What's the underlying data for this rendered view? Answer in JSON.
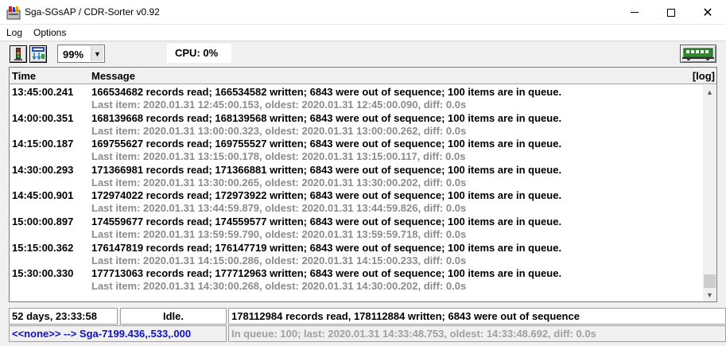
{
  "window": {
    "title": "Sga-SGsAP / CDR-Sorter  v0.92",
    "minimize_glyph": "",
    "maximize_glyph": "",
    "close_glyph": "✕"
  },
  "menu": {
    "log_label": "Log",
    "options_label": "Options"
  },
  "toolbar": {
    "zoom_value": "99%",
    "cpu_label": "CPU:  0%",
    "button_icons": [
      "traffic-light-icon",
      "auto-sort-icon",
      "train-icon"
    ]
  },
  "log": {
    "columns": {
      "time": "Time",
      "message": "Message",
      "log_button": "[log]"
    },
    "entries": [
      {
        "time": "13:45:00.241",
        "message": "166534682 records read; 166534582 written; 6843 were out of sequence; 100 items are in queue.",
        "detail": "Last item: 2020.01.31 12:45:00.153, oldest: 2020.01.31 12:45:00.090, diff: 0.0s"
      },
      {
        "time": "14:00:00.351",
        "message": "168139668 records read; 168139568 written; 6843 were out of sequence; 100 items are in queue.",
        "detail": "Last item: 2020.01.31 13:00:00.323, oldest: 2020.01.31 13:00:00.262, diff: 0.0s"
      },
      {
        "time": "14:15:00.187",
        "message": "169755627 records read; 169755527 written; 6843 were out of sequence; 100 items are in queue.",
        "detail": "Last item: 2020.01.31 13:15:00.178, oldest: 2020.01.31 13:15:00.117, diff: 0.0s"
      },
      {
        "time": "14:30:00.293",
        "message": "171366981 records read; 171366881 written; 6843 were out of sequence; 100 items are in queue.",
        "detail": "Last item: 2020.01.31 13:30:00.265, oldest: 2020.01.31 13:30:00.202, diff: 0.0s"
      },
      {
        "time": "14:45:00.901",
        "message": "172974022 records read; 172973922 written; 6843 were out of sequence; 100 items are in queue.",
        "detail": "Last item: 2020.01.31 13:44:59.879, oldest: 2020.01.31 13:44:59.826, diff: 0.0s"
      },
      {
        "time": "15:00:00.897",
        "message": "174559677 records read; 174559577 written; 6843 were out of sequence; 100 items are in queue.",
        "detail": "Last item: 2020.01.31 13:59:59.790, oldest: 2020.01.31 13:59:59.718, diff: 0.0s"
      },
      {
        "time": "15:15:00.362",
        "message": "176147819 records read; 176147719 written; 6843 were out of sequence; 100 items are in queue.",
        "detail": "Last item: 2020.01.31 14:15:00.286, oldest: 2020.01.31 14:15:00.233, diff: 0.0s"
      },
      {
        "time": "15:30:00.330",
        "message": "177713063 records read; 177712963 written; 6843 were out of sequence; 100 items are in queue.",
        "detail": "Last item: 2020.01.31 14:30:00.268, oldest: 2020.01.31 14:30:00.202, diff: 0.0s"
      }
    ]
  },
  "status": {
    "uptime": "52 days, 23:33:58",
    "state": "Idle.",
    "summary": "178112984 records read, 178112884 written; 6843 were out of sequence",
    "route": "<<none>> --> Sga-7199.436,.533,.000",
    "queue": "In queue: 100; last: 2020.01.31 14:33:48.753, oldest: 14:33:48.692, diff: 0.0s"
  },
  "colors": {
    "route_text": "#1010c8",
    "detail_text": "#8c8c8c",
    "queue_text": "#a0a0a0",
    "train_green": "#2e8b2e"
  }
}
